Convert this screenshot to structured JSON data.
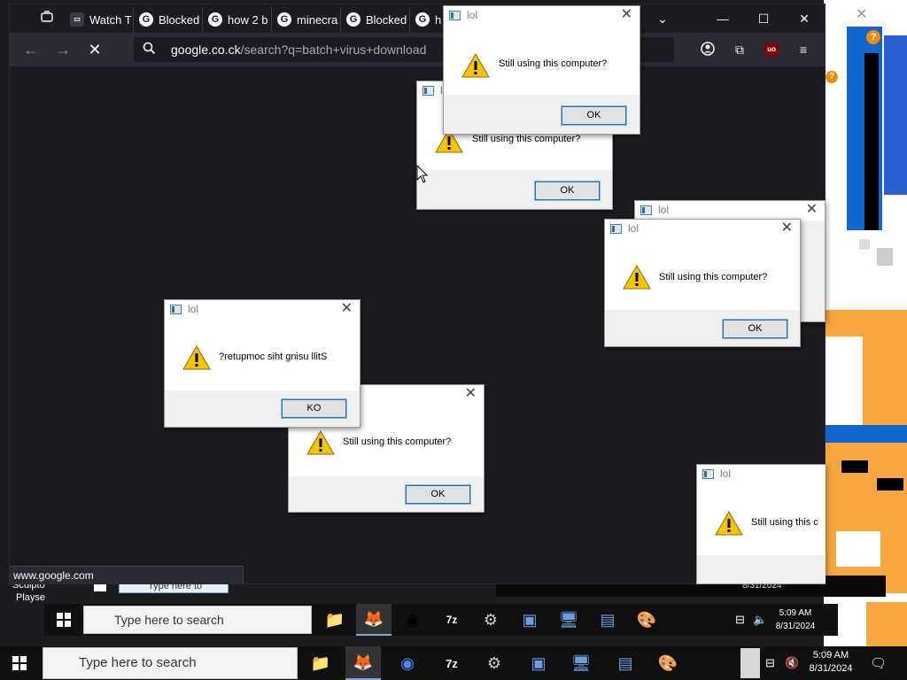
{
  "browser": {
    "tabs": [
      {
        "label": "Watch T",
        "icon": "media-favicon"
      },
      {
        "label": "Blocked",
        "icon": "google-favicon"
      },
      {
        "label": "how 2 b",
        "icon": "google-favicon"
      },
      {
        "label": "minecra",
        "icon": "google-favicon"
      },
      {
        "label": "Blocked",
        "icon": "google-favicon"
      },
      {
        "label": "h",
        "icon": "google-favicon"
      }
    ],
    "url_host": "google.co.ck",
    "url_path": "/search?q=batch+virus+download",
    "status_text": "www.google.com",
    "addon_badge": "uo"
  },
  "dialog": {
    "title": "lol",
    "message": "Still using this computer?",
    "message_truncated": "Still using this c",
    "message_reversed": "?retupmoc siht gnisu llitS",
    "ok_label": "OK",
    "ok_label_reversed": "KO"
  },
  "taskbar": {
    "search_placeholder": "Type here to search",
    "time": "5:09 AM",
    "date": "8/31/2024",
    "mini_time": "5:09 AM",
    "mini_date": "8/31/2024",
    "ghost_date": "8/31/2024",
    "ghost_search": "Type here to"
  },
  "desktop": {
    "ghost_text_1": "Sculpto",
    "ghost_text_2": "Playse"
  },
  "colors": {
    "browser_bg": "#1c1b22",
    "toolbar_bg": "#2b2a33",
    "dialog_bg": "#f0f0f0",
    "button_focus": "#0078d7",
    "warning_yellow": "#f5c400"
  }
}
